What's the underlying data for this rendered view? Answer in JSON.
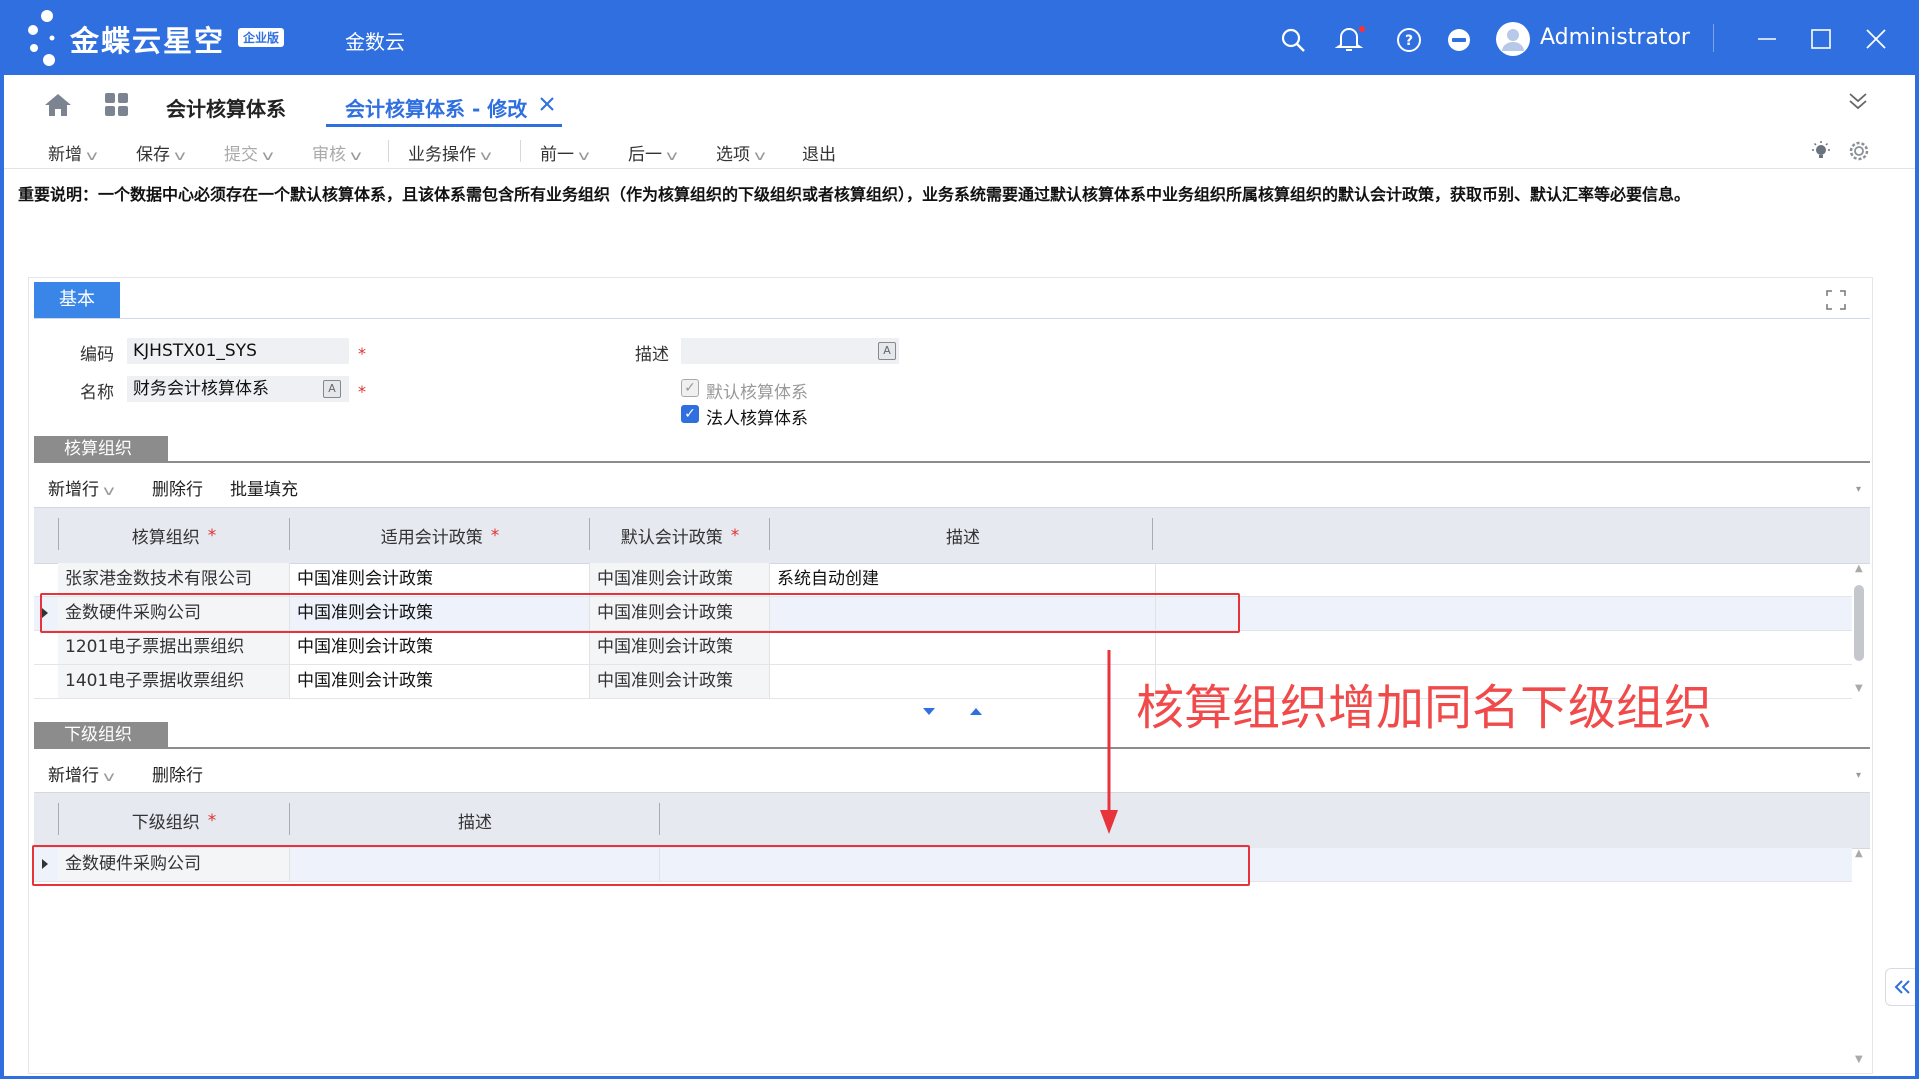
{
  "titlebar": {
    "logo": "金蝶云星空",
    "logo_badge": "企业版",
    "app_name": "金数云",
    "user": "Administrator",
    "colors": {
      "bar": "#2f6fe0"
    }
  },
  "tabs": [
    {
      "label": "会计核算体系"
    },
    {
      "label": "会计核算体系 - 修改",
      "active": true
    }
  ],
  "toolbar": {
    "new": "新增",
    "save": "保存",
    "submit": "提交",
    "audit": "审核",
    "biz": "业务操作",
    "prev": "前一",
    "next": "后一",
    "options": "选项",
    "exit": "退出"
  },
  "notice": "重要说明：一个数据中心必须存在一个默认核算体系，且该体系需包含所有业务组织（作为核算组织的下级组织或者核算组织），业务系统需要通过默认核算体系中业务组织所属核算组织的默认会计政策，获取币别、默认汇率等必要信息。",
  "basic": {
    "tab": "基本",
    "code_label": "编码",
    "code_value": "KJHSTX01_SYS",
    "name_label": "名称",
    "name_value": "财务会计核算体系",
    "desc_label": "描述",
    "desc_value": "",
    "required_mark": "*",
    "lang_mark": "A",
    "default_system_label": "默认核算体系",
    "default_system_checked": true,
    "legal_system_label": "法人核算体系",
    "legal_system_checked": true
  },
  "acct_orgs": {
    "section": "核算组织",
    "tools": {
      "add_row": "新增行",
      "delete_row": "删除行",
      "batch_fill": "批量填充"
    },
    "headers": [
      "核算组织",
      "适用会计政策",
      "默认会计政策",
      "描述"
    ],
    "rows": [
      {
        "org": "张家港金数技术有限公司",
        "policy": "中国准则会计政策",
        "default_policy": "中国准则会计政策",
        "desc": "系统自动创建"
      },
      {
        "org": "金数硬件采购公司",
        "policy": "中国准则会计政策",
        "default_policy": "中国准则会计政策",
        "desc": ""
      },
      {
        "org": "1201电子票据出票组织",
        "policy": "中国准则会计政策",
        "default_policy": "中国准则会计政策",
        "desc": ""
      },
      {
        "org": "1401电子票据收票组织",
        "policy": "中国准则会计政策",
        "default_policy": "中国准则会计政策",
        "desc": ""
      }
    ]
  },
  "sub_orgs": {
    "section": "下级组织",
    "tools": {
      "add_row": "新增行",
      "delete_row": "删除行"
    },
    "headers": [
      "下级组织",
      "描述"
    ],
    "rows": [
      {
        "org": "金数硬件采购公司",
        "desc": ""
      }
    ]
  },
  "annotation": {
    "text": "核算组织增加同名下级组织",
    "color": "#e8323c"
  }
}
